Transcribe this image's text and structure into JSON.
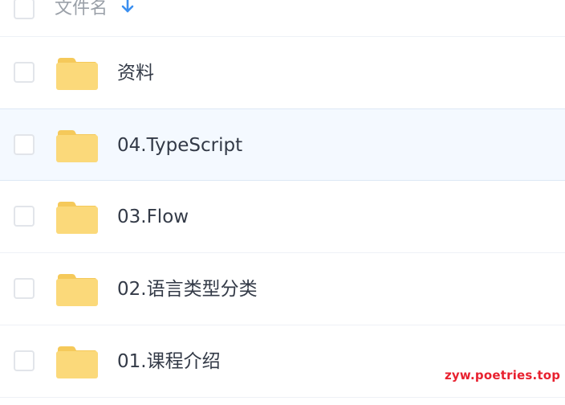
{
  "header": {
    "column_label": "文件名",
    "sort_icon": "arrow-down-icon"
  },
  "files": [
    {
      "name": "资料",
      "icon": "folder-icon",
      "selected": false
    },
    {
      "name": "04.TypeScript",
      "icon": "folder-icon",
      "selected": true
    },
    {
      "name": "03.Flow",
      "icon": "folder-icon",
      "selected": false
    },
    {
      "name": "02.语言类型分类",
      "icon": "folder-icon",
      "selected": false
    },
    {
      "name": "01.课程介绍",
      "icon": "folder-icon",
      "selected": false
    }
  ],
  "watermark": "zyw.poetries.top",
  "colors": {
    "folder": "#fbd97a",
    "folder_tab": "#f5c95a",
    "sort_arrow": "#3b8ff0",
    "selected_row": "#f4f9ff",
    "watermark": "#e8212f"
  }
}
